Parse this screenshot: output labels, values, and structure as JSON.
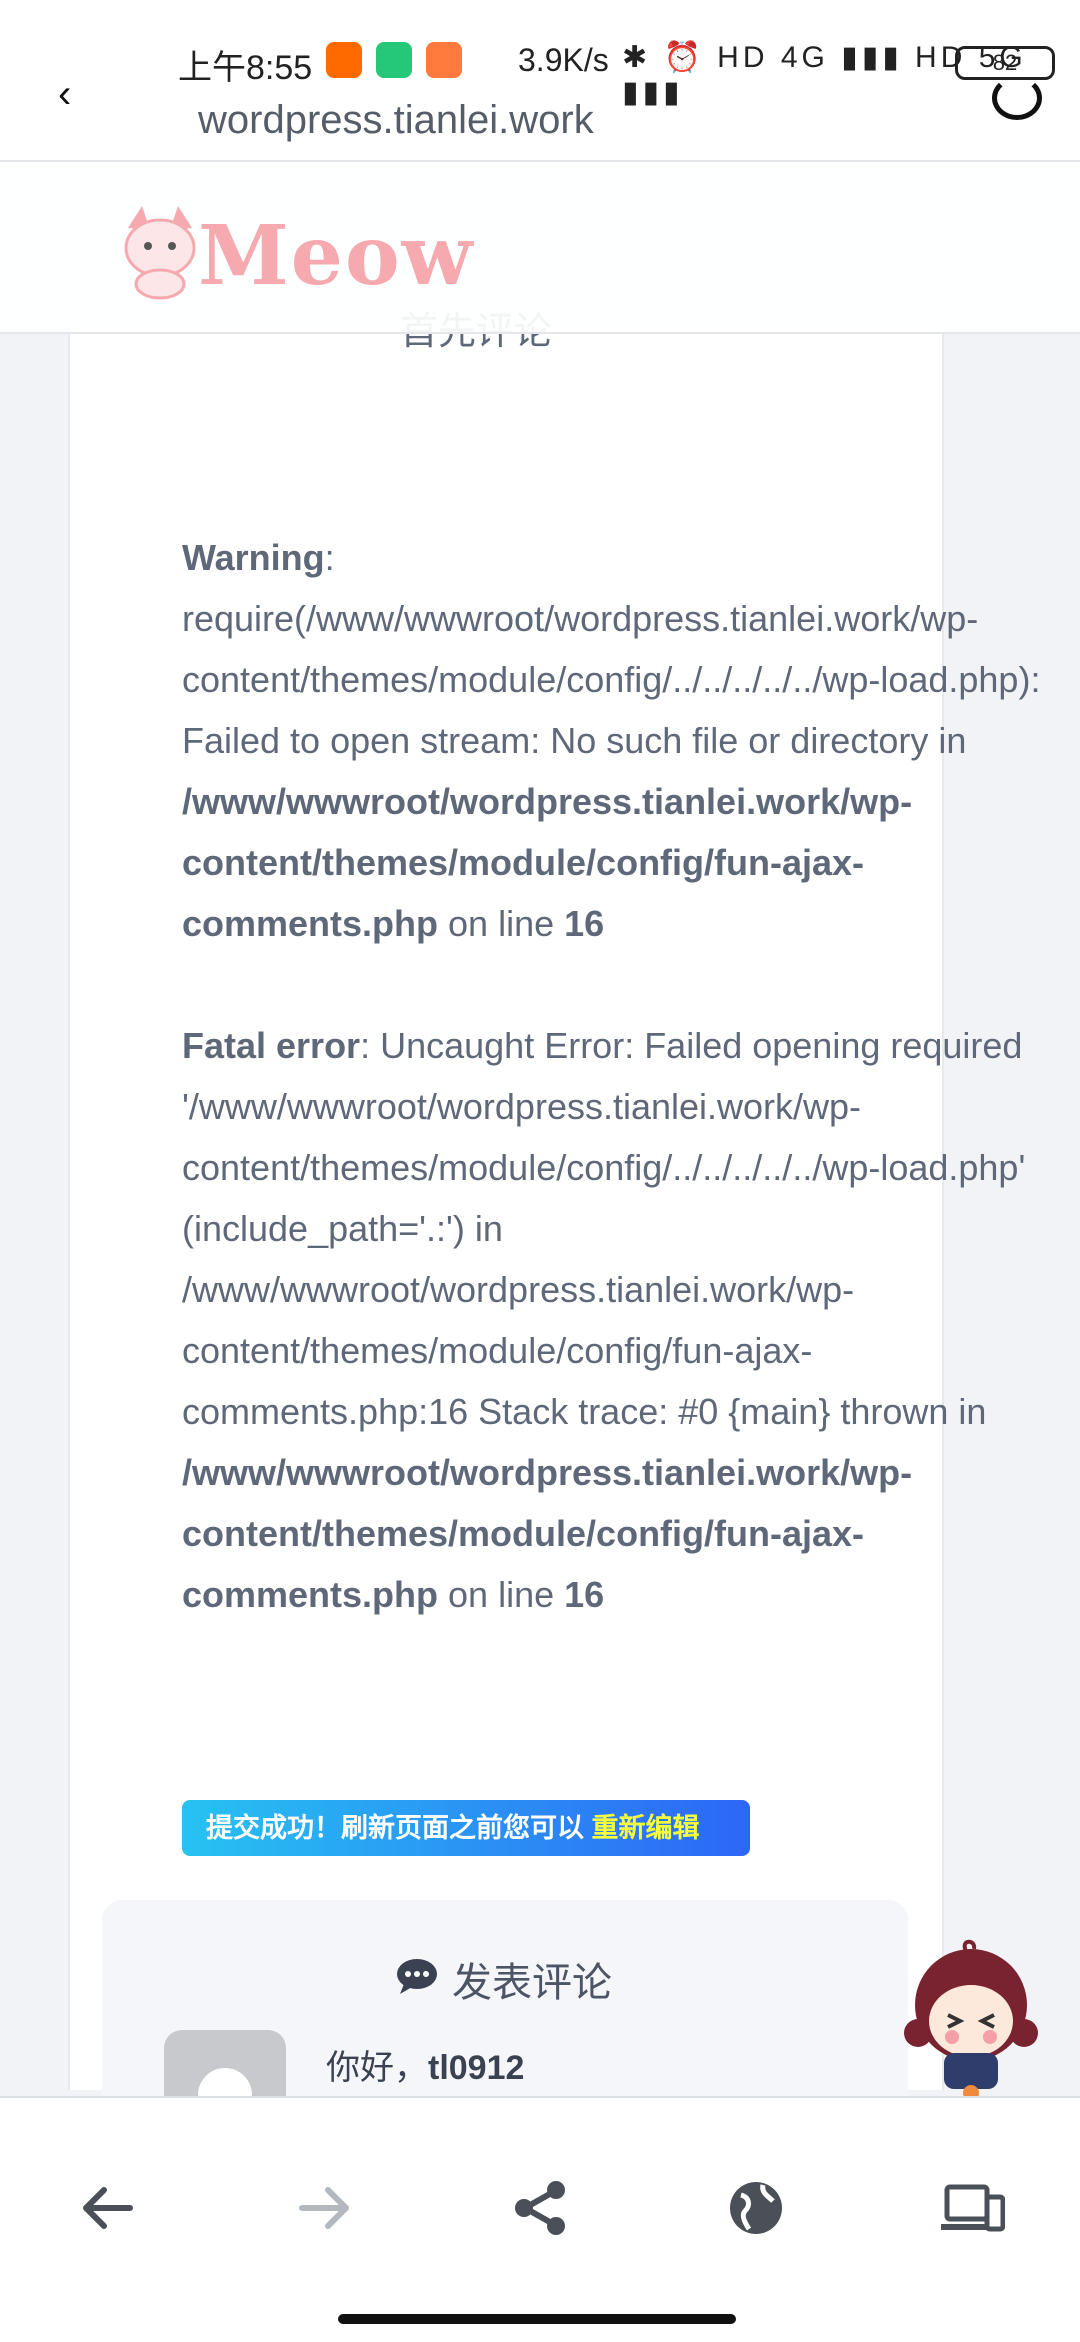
{
  "status_bar": {
    "time": "上午8:55",
    "net_speed": "3.9K/s",
    "sys_icons_text": "✱ ⏰ HD 4G ▮▮▮ HD 5G ▮▮▮",
    "battery": "82"
  },
  "browser": {
    "url": "wordpress.tianlei.work"
  },
  "site": {
    "logo_text": "Meow"
  },
  "comments": {
    "first_comment_label": "首先评论",
    "warning_label": "Warning",
    "warning_text": ": require(/www/wwwroot/wordpress.tianlei.work/wp-content/themes/module/config/../../../../../wp-load.php): Failed to open stream: No such file or directory in ",
    "warning_path": "/www/wwwroot/wordpress.tianlei.work/wp-content/themes/module/config/fun-ajax-comments.php",
    "on_line": " on line ",
    "line_no": "16",
    "fatal_label": "Fatal error",
    "fatal_text": ": Uncaught Error: Failed opening required '/www/wwwroot/wordpress.tianlei.work/wp-content/themes/module/config/../../../../../wp-load.php' (include_path='.:') in /www/wwwroot/wordpress.tianlei.work/wp-content/themes/module/config/fun-ajax-comments.php:16 Stack trace: #0 {main} thrown in ",
    "fatal_path": "/www/wwwroot/wordpress.tianlei.work/wp-content/themes/module/config/fun-ajax-comments.php",
    "fatal_line_no": "16",
    "success_msg": "提交成功！刷新页面之前您可以",
    "re_edit": "重新编辑",
    "form_title": "发表评论",
    "greeting_prefix": "你好，",
    "username": "tl0912"
  },
  "icons": {
    "back": "arrow-left-icon",
    "forward": "arrow-right-icon",
    "share": "share-icon",
    "globe": "globe-icon",
    "devices": "devices-icon"
  },
  "colors": {
    "success_start": "#27c2f2",
    "success_end": "#2d66f6",
    "re_edit": "#f7ff3b",
    "logo_pink": "#f6a9ae"
  }
}
